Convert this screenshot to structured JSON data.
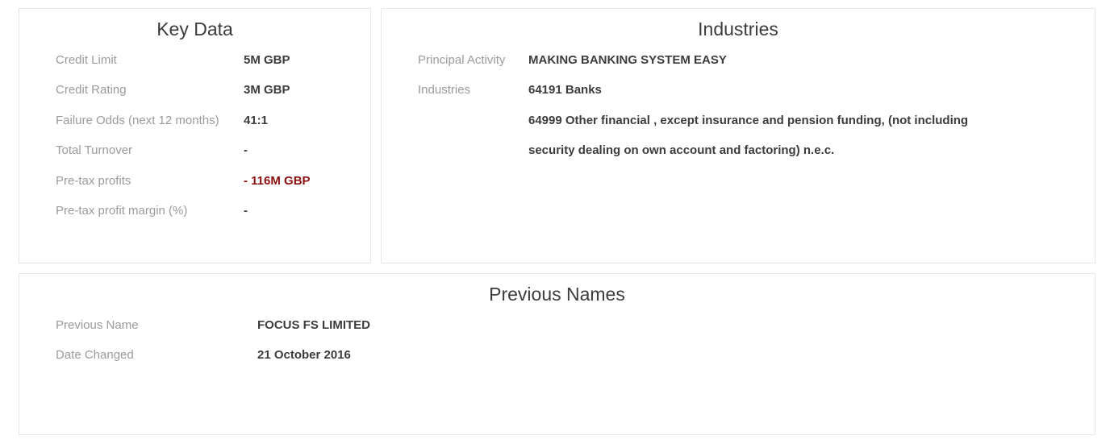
{
  "key_data": {
    "title": "Key Data",
    "rows": [
      {
        "label": "Credit Limit",
        "value": "5M GBP"
      },
      {
        "label": "Credit Rating",
        "value": "3M GBP"
      },
      {
        "label": "Failure Odds (next 12 months)",
        "value": "41:1"
      },
      {
        "label": "Total Turnover",
        "value": "-"
      },
      {
        "label": "Pre-tax profits",
        "value": "- 116M GBP"
      },
      {
        "label": "Pre-tax profit margin (%)",
        "value": "-"
      }
    ]
  },
  "industries": {
    "title": "Industries",
    "principal_activity_label": "Principal Activity",
    "principal_activity_value": "MAKING BANKING SYSTEM EASY",
    "industries_label": "Industries",
    "industry_items": [
      "64191 Banks",
      "64999 Other financial , except insurance and pension funding, (not including",
      "security dealing on own account and factoring) n.e.c."
    ]
  },
  "previous_names": {
    "title": "Previous Names",
    "rows": [
      {
        "label": "Previous Name",
        "value": "FOCUS FS LIMITED"
      },
      {
        "label": "Date Changed",
        "value": "21 October 2016"
      }
    ]
  },
  "colors": {
    "label": "#9b9b9b",
    "value": "#3c3c3c",
    "negative": "#8b0f0f",
    "border": "#e7e7e7"
  }
}
